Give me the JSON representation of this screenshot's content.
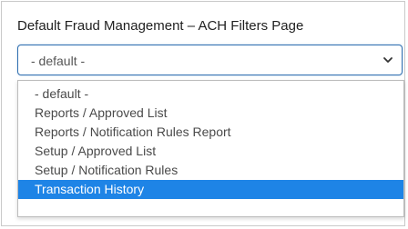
{
  "section": {
    "title": "Default Fraud Management – ACH Filters Page"
  },
  "select": {
    "value": "- default -",
    "chevron_icon": "chevron-down-icon"
  },
  "dropdown": {
    "options": [
      "- default -",
      "Reports / Approved List",
      "Reports / Notification Rules Report",
      "Setup / Approved List",
      "Setup / Notification Rules",
      "Transaction History"
    ],
    "highlighted_index": 5
  },
  "colors": {
    "highlight": "#1e84e6",
    "focus_border": "#2f6fb0"
  }
}
